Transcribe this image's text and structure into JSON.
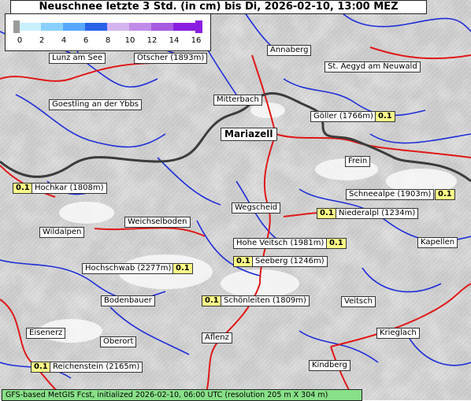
{
  "title": "Neuschnee letzte 3 Std. (in cm) bis Di, 2026-02-10, 13:00 MEZ",
  "legend": {
    "ticks": [
      "0",
      "2",
      "4",
      "6",
      "8",
      "10",
      "12",
      "14",
      "16"
    ],
    "colors": [
      "#9a9a9a",
      "#c8f0ff",
      "#8ad0ff",
      "#56a8ff",
      "#2a62e8",
      "#d4b4f0",
      "#c08ce8",
      "#a85ae0",
      "#8a1ee0"
    ]
  },
  "footer": "GFS-based MetGIS Fcst, initialized 2026-02-10, 06:00 UTC  (resolution 205 m X 304 m)",
  "places": [
    {
      "id": "lunz",
      "name": "Lunz am See"
    },
    {
      "id": "oetscher",
      "name": "Ötscher (1893m)"
    },
    {
      "id": "annaberg",
      "name": "Annaberg"
    },
    {
      "id": "aegyd",
      "name": "St. Aegyd am Neuwald"
    },
    {
      "id": "goestling",
      "name": "Goestling an der Ybbs"
    },
    {
      "id": "mitterbach",
      "name": "Mitterbach"
    },
    {
      "id": "goeller",
      "name": "Göller (1766m)",
      "value": "0.1"
    },
    {
      "id": "mariazell",
      "name": "Mariazell"
    },
    {
      "id": "frein",
      "name": "Frein"
    },
    {
      "id": "hochkar",
      "name": "Hochkar (1808m)",
      "value": "0.1"
    },
    {
      "id": "schneealpe",
      "name": "Schneealpe (1903m)",
      "value": "0.1"
    },
    {
      "id": "wegscheid",
      "name": "Wegscheid"
    },
    {
      "id": "niederalpl",
      "name": "Niederalpl (1234m)",
      "value": "0.1"
    },
    {
      "id": "weichselboden",
      "name": "Weichselboden"
    },
    {
      "id": "wildalpen",
      "name": "Wildalpen"
    },
    {
      "id": "veitsch_hohe",
      "name": "Hohe Veitsch (1981m)",
      "value": "0.1"
    },
    {
      "id": "kapellen",
      "name": "Kapellen"
    },
    {
      "id": "seeberg",
      "name": "Seeberg (1246m)",
      "value": "0.1"
    },
    {
      "id": "hochschwab",
      "name": "Hochschwab (2277m)",
      "value": "0.1"
    },
    {
      "id": "bodenbauer",
      "name": "Bodenbauer"
    },
    {
      "id": "schoenleiten",
      "name": "Schönleiten (1809m)",
      "value": "0.1"
    },
    {
      "id": "veitsch",
      "name": "Veitsch"
    },
    {
      "id": "eisenerz",
      "name": "Eisenerz"
    },
    {
      "id": "oberort",
      "name": "Oberort"
    },
    {
      "id": "aflenz",
      "name": "Aflenz"
    },
    {
      "id": "krieglach",
      "name": "Krieglach"
    },
    {
      "id": "reichenstein",
      "name": "Reichenstein (2165m)",
      "value": "0.1"
    },
    {
      "id": "kindberg",
      "name": "Kindberg"
    }
  ]
}
